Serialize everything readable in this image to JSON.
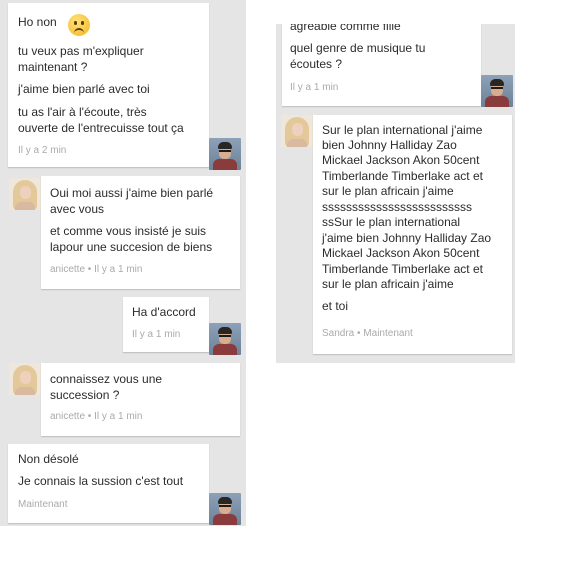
{
  "left_chat": {
    "messages": [
      {
        "sender": "me",
        "text": [
          "Ho non",
          "tu veux pas m'expliquer",
          "maintenant ?",
          "j'aime bien parlé avec toi",
          "tu as l'air à l'écoute, très",
          "ouverte de l'entrecuisse tout ça"
        ],
        "meta": "Il y a 2 min",
        "emoji": "sad-face"
      },
      {
        "sender": "anicette",
        "text": [
          "Oui moi aussi j'aime bien parlé",
          "avec vous",
          "et comme vous insisté je suis",
          "lapour une succesion de biens"
        ],
        "meta": "anicette • Il y a 1 min"
      },
      {
        "sender": "me",
        "text": [
          "Ha d'accord"
        ],
        "meta": "Il y a 1 min"
      },
      {
        "sender": "anicette",
        "text": [
          "connaissez vous une",
          "succession ?"
        ],
        "meta": "anicette • Il y a 1 min"
      },
      {
        "sender": "me",
        "text": [
          "Non désolé",
          "Je connais la sussion c'est tout"
        ],
        "meta": "Maintenant"
      }
    ]
  },
  "right_chat": {
    "messages": [
      {
        "sender": "me",
        "text": [
          "agréable comme fille",
          "quel genre de musique tu",
          "écoutes ?"
        ],
        "meta": "Il y a 1 min"
      },
      {
        "sender": "Sandra",
        "text": [
          "Sur le plan international j'aime",
          "bien Johnny Halliday Zao",
          "Mickael Jackson Akon 50cent",
          "Timberlande Timberlake act et",
          "sur le plan africain j'aime",
          "sssssssssssssssssssssssss",
          "ssSur le plan international",
          "j'aime bien Johnny Halliday Zao",
          "Mickael Jackson Akon 50cent",
          "Timberlande Timberlake act et",
          "sur le plan africain j'aime",
          "et toi"
        ],
        "meta": "Sandra • Maintenant"
      }
    ]
  },
  "colors": {
    "panel_bg": "#e5e5e5",
    "bubble_bg": "#ffffff",
    "text": "#2b2b2b",
    "meta": "#aaaaaa"
  }
}
